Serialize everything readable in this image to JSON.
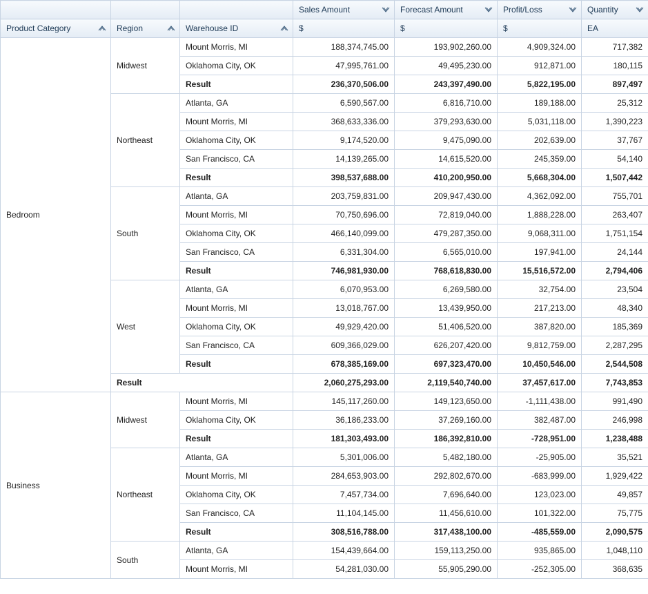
{
  "columns": {
    "product_category": "Product Category",
    "region": "Region",
    "warehouse_id": "Warehouse ID",
    "sales_amount": "Sales Amount",
    "forecast_amount": "Forecast Amount",
    "profit_loss": "Profit/Loss",
    "quantity": "Quantity"
  },
  "units": {
    "sales_amount": "$",
    "forecast_amount": "$",
    "profit_loss": "$",
    "quantity": "EA"
  },
  "labels": {
    "result": "Result"
  },
  "categories": [
    {
      "name": "Bedroom",
      "regions": [
        {
          "name": "Midwest",
          "rows": [
            {
              "warehouse": "Mount Morris, MI",
              "sales": "188,374,745.00",
              "forecast": "193,902,260.00",
              "pl": "4,909,324.00",
              "qty": "717,382"
            },
            {
              "warehouse": "Oklahoma City, OK",
              "sales": "47,995,761.00",
              "forecast": "49,495,230.00",
              "pl": "912,871.00",
              "qty": "180,115"
            }
          ],
          "result": {
            "sales": "236,370,506.00",
            "forecast": "243,397,490.00",
            "pl": "5,822,195.00",
            "qty": "897,497"
          }
        },
        {
          "name": "Northeast",
          "rows": [
            {
              "warehouse": "Atlanta, GA",
              "sales": "6,590,567.00",
              "forecast": "6,816,710.00",
              "pl": "189,188.00",
              "qty": "25,312"
            },
            {
              "warehouse": "Mount Morris, MI",
              "sales": "368,633,336.00",
              "forecast": "379,293,630.00",
              "pl": "5,031,118.00",
              "qty": "1,390,223"
            },
            {
              "warehouse": "Oklahoma City, OK",
              "sales": "9,174,520.00",
              "forecast": "9,475,090.00",
              "pl": "202,639.00",
              "qty": "37,767"
            },
            {
              "warehouse": "San Francisco, CA",
              "sales": "14,139,265.00",
              "forecast": "14,615,520.00",
              "pl": "245,359.00",
              "qty": "54,140"
            }
          ],
          "result": {
            "sales": "398,537,688.00",
            "forecast": "410,200,950.00",
            "pl": "5,668,304.00",
            "qty": "1,507,442"
          }
        },
        {
          "name": "South",
          "rows": [
            {
              "warehouse": "Atlanta, GA",
              "sales": "203,759,831.00",
              "forecast": "209,947,430.00",
              "pl": "4,362,092.00",
              "qty": "755,701"
            },
            {
              "warehouse": "Mount Morris, MI",
              "sales": "70,750,696.00",
              "forecast": "72,819,040.00",
              "pl": "1,888,228.00",
              "qty": "263,407"
            },
            {
              "warehouse": "Oklahoma City, OK",
              "sales": "466,140,099.00",
              "forecast": "479,287,350.00",
              "pl": "9,068,311.00",
              "qty": "1,751,154"
            },
            {
              "warehouse": "San Francisco, CA",
              "sales": "6,331,304.00",
              "forecast": "6,565,010.00",
              "pl": "197,941.00",
              "qty": "24,144"
            }
          ],
          "result": {
            "sales": "746,981,930.00",
            "forecast": "768,618,830.00",
            "pl": "15,516,572.00",
            "qty": "2,794,406"
          }
        },
        {
          "name": "West",
          "rows": [
            {
              "warehouse": "Atlanta, GA",
              "sales": "6,070,953.00",
              "forecast": "6,269,580.00",
              "pl": "32,754.00",
              "qty": "23,504"
            },
            {
              "warehouse": "Mount Morris, MI",
              "sales": "13,018,767.00",
              "forecast": "13,439,950.00",
              "pl": "217,213.00",
              "qty": "48,340"
            },
            {
              "warehouse": "Oklahoma City, OK",
              "sales": "49,929,420.00",
              "forecast": "51,406,520.00",
              "pl": "387,820.00",
              "qty": "185,369"
            },
            {
              "warehouse": "San Francisco, CA",
              "sales": "609,366,029.00",
              "forecast": "626,207,420.00",
              "pl": "9,812,759.00",
              "qty": "2,287,295"
            }
          ],
          "result": {
            "sales": "678,385,169.00",
            "forecast": "697,323,470.00",
            "pl": "10,450,546.00",
            "qty": "2,544,508"
          }
        }
      ],
      "result": {
        "sales": "2,060,275,293.00",
        "forecast": "2,119,540,740.00",
        "pl": "37,457,617.00",
        "qty": "7,743,853"
      }
    },
    {
      "name": "Business",
      "regions": [
        {
          "name": "Midwest",
          "rows": [
            {
              "warehouse": "Mount Morris, MI",
              "sales": "145,117,260.00",
              "forecast": "149,123,650.00",
              "pl": "-1,111,438.00",
              "qty": "991,490"
            },
            {
              "warehouse": "Oklahoma City, OK",
              "sales": "36,186,233.00",
              "forecast": "37,269,160.00",
              "pl": "382,487.00",
              "qty": "246,998"
            }
          ],
          "result": {
            "sales": "181,303,493.00",
            "forecast": "186,392,810.00",
            "pl": "-728,951.00",
            "qty": "1,238,488"
          }
        },
        {
          "name": "Northeast",
          "rows": [
            {
              "warehouse": "Atlanta, GA",
              "sales": "5,301,006.00",
              "forecast": "5,482,180.00",
              "pl": "-25,905.00",
              "qty": "35,521"
            },
            {
              "warehouse": "Mount Morris, MI",
              "sales": "284,653,903.00",
              "forecast": "292,802,670.00",
              "pl": "-683,999.00",
              "qty": "1,929,422"
            },
            {
              "warehouse": "Oklahoma City, OK",
              "sales": "7,457,734.00",
              "forecast": "7,696,640.00",
              "pl": "123,023.00",
              "qty": "49,857"
            },
            {
              "warehouse": "San Francisco, CA",
              "sales": "11,104,145.00",
              "forecast": "11,456,610.00",
              "pl": "101,322.00",
              "qty": "75,775"
            }
          ],
          "result": {
            "sales": "308,516,788.00",
            "forecast": "317,438,100.00",
            "pl": "-485,559.00",
            "qty": "2,090,575"
          }
        },
        {
          "name": "South",
          "rows": [
            {
              "warehouse": "Atlanta, GA",
              "sales": "154,439,664.00",
              "forecast": "159,113,250.00",
              "pl": "935,865.00",
              "qty": "1,048,110"
            },
            {
              "warehouse": "Mount Morris, MI",
              "sales": "54,281,030.00",
              "forecast": "55,905,290.00",
              "pl": "-252,305.00",
              "qty": "368,635"
            }
          ]
        }
      ]
    }
  ]
}
